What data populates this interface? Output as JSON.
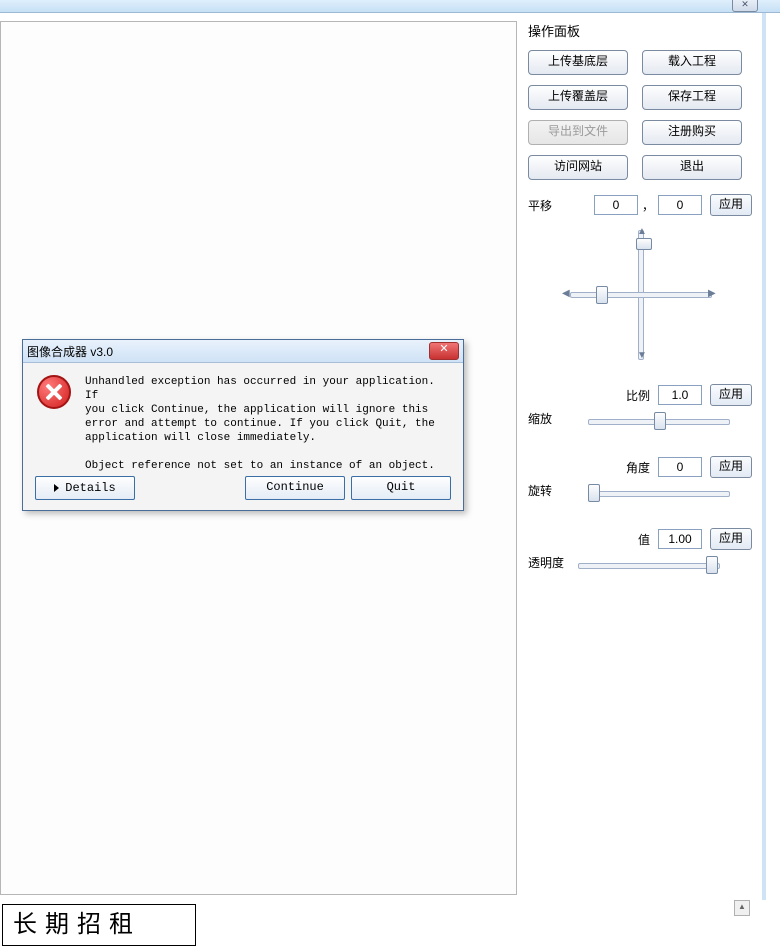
{
  "titlebar": {
    "close_glyph": "✕"
  },
  "panel": {
    "title": "操作面板",
    "buttons": {
      "upload_base": "上传基底层",
      "load_project": "载入工程",
      "upload_overlay": "上传覆盖层",
      "save_project": "保存工程",
      "export_file": "导出到文件",
      "register_buy": "注册购买",
      "visit_site": "访问网站",
      "exit": "退出"
    }
  },
  "translate": {
    "label": "平移",
    "x": "0",
    "sep": "，",
    "y": "0",
    "apply": "应用"
  },
  "scale": {
    "title": "缩放",
    "label": "比例",
    "value": "1.0",
    "apply": "应用"
  },
  "rotate": {
    "title": "旋转",
    "label": "角度",
    "value": "0",
    "apply": "应用"
  },
  "opacity": {
    "title": "透明度",
    "label": "值",
    "value": "1.00",
    "apply": "应用"
  },
  "dialog": {
    "title": "图像合成器 v3.0",
    "close_glyph": "✕",
    "message": "Unhandled exception has occurred in your application. If\nyou click Continue, the application will ignore this\nerror and attempt to continue. If you click Quit, the\napplication will close immediately.\n\nObject reference not set to an instance of an object.",
    "details": "Details",
    "continue": "Continue",
    "quit": "Quit"
  },
  "ad": {
    "text": "长期招租"
  },
  "scroll_up_glyph": "▲"
}
